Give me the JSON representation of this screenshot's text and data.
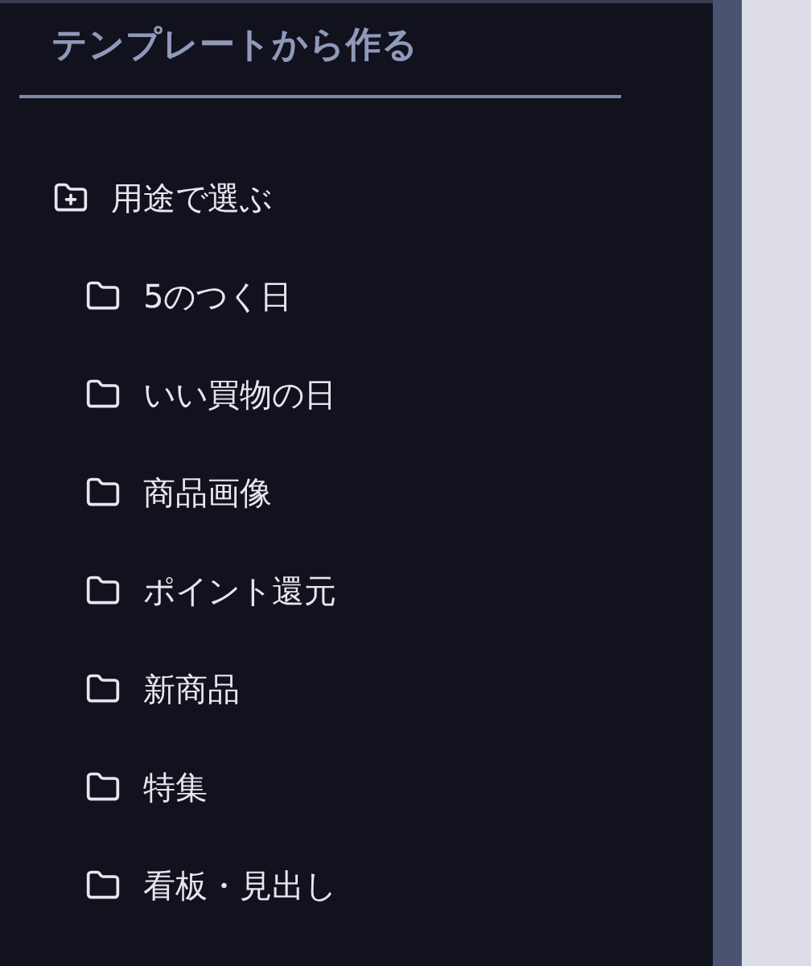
{
  "sidebar": {
    "title": "テンプレートから作る",
    "tree": [
      {
        "label": "用途で選ぶ",
        "children": [
          {
            "label": "5のつく日"
          },
          {
            "label": "いい買物の日"
          },
          {
            "label": "商品画像"
          },
          {
            "label": "ポイント還元"
          },
          {
            "label": "新商品"
          },
          {
            "label": "特集"
          },
          {
            "label": "看板・見出し"
          }
        ]
      }
    ]
  }
}
